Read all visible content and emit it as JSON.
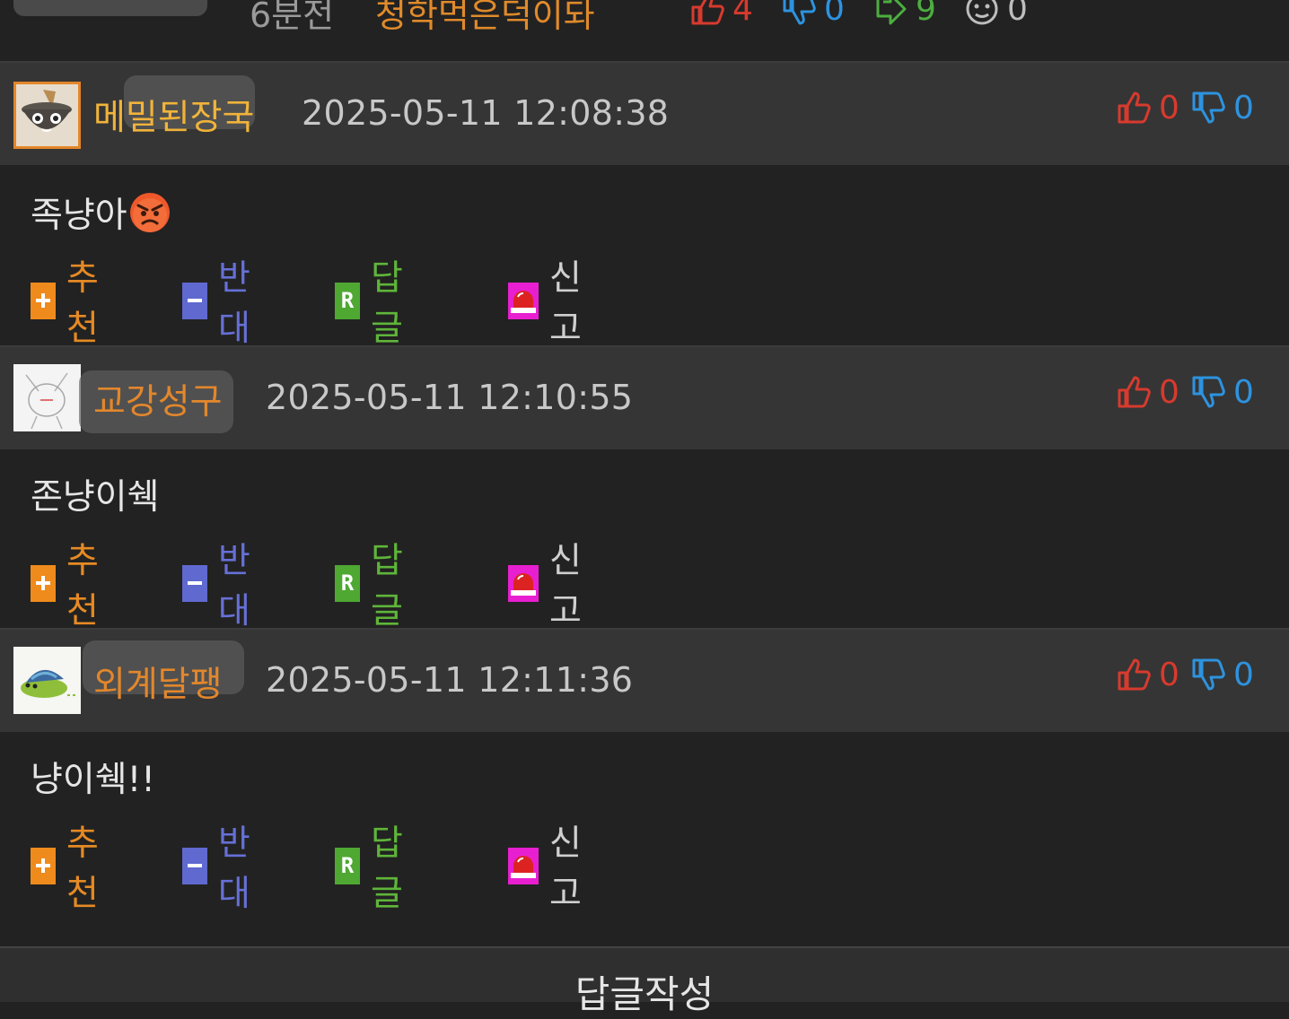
{
  "post_meta": {
    "time_ago": "6분전",
    "author": "청학먹은덕이돠",
    "likes": "4",
    "dislikes": "0",
    "shares": "9",
    "emotes": "0"
  },
  "comments": [
    {
      "nickname": "메밀된장국",
      "timestamp": "2025-05-11 12:08:38",
      "likes": "0",
      "dislikes": "0",
      "text": "족냥아",
      "emoji": "angry-face-icon"
    },
    {
      "nickname": "교강성구",
      "timestamp": "2025-05-11 12:10:55",
      "likes": "0",
      "dislikes": "0",
      "text": "존냥이쉑"
    },
    {
      "nickname": "외계달팽",
      "timestamp": "2025-05-11 12:11:36",
      "likes": "0",
      "dislikes": "0",
      "text": "냥이쉑!!"
    }
  ],
  "actions": {
    "recommend": "추천",
    "oppose": "반대",
    "reply": "답글",
    "report": "신고"
  },
  "write_button": "답글작성",
  "colors": {
    "background": "#222222",
    "header_row": "#353535",
    "nickname": "#e2872c",
    "like": "#d83a2e",
    "dislike": "#2d93df",
    "recommend": "#e58a24",
    "oppose": "#6670d6",
    "reply": "#5fb53a",
    "report_icon": "#e81fd0"
  }
}
